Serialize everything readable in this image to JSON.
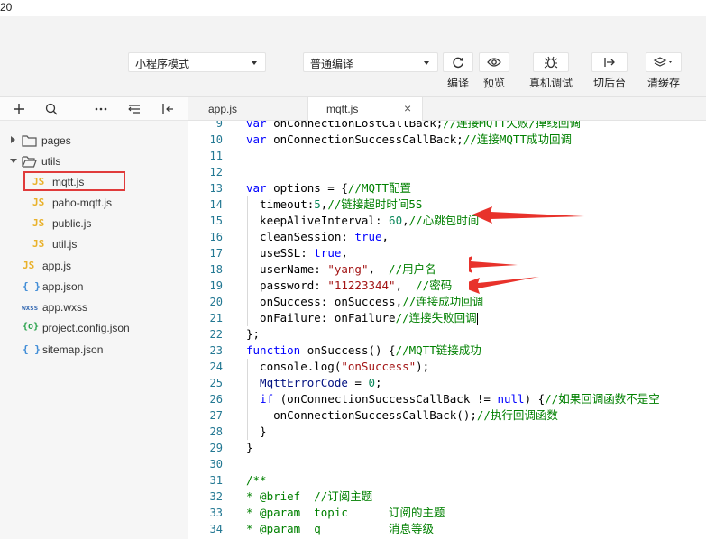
{
  "top_strip": {
    "text": "20"
  },
  "toolbar": {
    "mode_select": "小程序模式",
    "compile_select": "普通编译",
    "buttons": [
      {
        "label": "编译",
        "icon": "refresh-icon"
      },
      {
        "label": "预览",
        "icon": "eye-icon"
      },
      {
        "label": "真机调试",
        "icon": "bug-icon"
      },
      {
        "label": "切后台",
        "icon": "switch-background-icon"
      },
      {
        "label": "清缓存",
        "icon": "layers-icon"
      }
    ]
  },
  "sidebar": {
    "tools": [
      "add-icon",
      "search-icon",
      "more-icon",
      "sort-icon",
      "collapse-icon"
    ],
    "tree": [
      {
        "name": "pages",
        "type": "folder",
        "expanded": false
      },
      {
        "name": "utils",
        "type": "folder",
        "expanded": true
      },
      {
        "name": "mqtt.js",
        "type": "js",
        "badge": "JS",
        "selected": true
      },
      {
        "name": "paho-mqtt.js",
        "type": "js",
        "badge": "JS"
      },
      {
        "name": "public.js",
        "type": "js",
        "badge": "JS"
      },
      {
        "name": "util.js",
        "type": "js",
        "badge": "JS"
      },
      {
        "name": "app.js",
        "type": "js",
        "badge": "JS"
      },
      {
        "name": "app.json",
        "type": "json",
        "badge": "{ }"
      },
      {
        "name": "app.wxss",
        "type": "wxss",
        "badge": "wxss"
      },
      {
        "name": "project.config.json",
        "type": "config",
        "badge": "{o}"
      },
      {
        "name": "sitemap.json",
        "type": "json",
        "badge": "{ }"
      }
    ]
  },
  "tabs": [
    {
      "label": "app.js",
      "active": false
    },
    {
      "label": "mqtt.js",
      "active": true,
      "close": "×"
    }
  ],
  "editor": {
    "lines": [
      {
        "n": "9",
        "tokens": [
          [
            "kw",
            "var"
          ],
          [
            "plain",
            " onConnectionLostCallBack;"
          ],
          [
            "cm",
            "//连接MQTT失败/掉线回调"
          ]
        ]
      },
      {
        "n": "10",
        "tokens": [
          [
            "kw",
            "var"
          ],
          [
            "plain",
            " onConnectionSuccessCallBack;"
          ],
          [
            "cm",
            "//连接MQTT成功回调"
          ]
        ]
      },
      {
        "n": "11",
        "tokens": []
      },
      {
        "n": "12",
        "tokens": []
      },
      {
        "n": "13",
        "tokens": [
          [
            "kw",
            "var"
          ],
          [
            "plain",
            " options = {"
          ],
          [
            "cm",
            "//MQTT配置"
          ]
        ]
      },
      {
        "n": "14",
        "tokens": [
          [
            "plain",
            "  timeout:"
          ],
          [
            "num",
            "5"
          ],
          [
            "plain",
            ","
          ],
          [
            "cm",
            "//链接超时时间5S"
          ]
        ]
      },
      {
        "n": "15",
        "tokens": [
          [
            "plain",
            "  keepAliveInterval: "
          ],
          [
            "num",
            "60"
          ],
          [
            "plain",
            ","
          ],
          [
            "cm",
            "//心跳包时间"
          ]
        ]
      },
      {
        "n": "16",
        "tokens": [
          [
            "plain",
            "  cleanSession: "
          ],
          [
            "kw",
            "true"
          ],
          [
            "plain",
            ","
          ]
        ]
      },
      {
        "n": "17",
        "tokens": [
          [
            "plain",
            "  useSSL: "
          ],
          [
            "kw",
            "true"
          ],
          [
            "plain",
            ","
          ]
        ]
      },
      {
        "n": "18",
        "tokens": [
          [
            "plain",
            "  userName: "
          ],
          [
            "str",
            "\"yang\""
          ],
          [
            "plain",
            ",  "
          ],
          [
            "cm",
            "//用户名"
          ]
        ]
      },
      {
        "n": "19",
        "tokens": [
          [
            "plain",
            "  password: "
          ],
          [
            "str",
            "\"11223344\""
          ],
          [
            "plain",
            ",  "
          ],
          [
            "cm",
            "//密码"
          ]
        ]
      },
      {
        "n": "20",
        "tokens": [
          [
            "plain",
            "  onSuccess: onSuccess,"
          ],
          [
            "cm",
            "//连接成功回调"
          ]
        ]
      },
      {
        "n": "21",
        "tokens": [
          [
            "plain",
            "  onFailure: onFailure"
          ],
          [
            "cm",
            "//连接失败回调"
          ]
        ],
        "cursor": true
      },
      {
        "n": "22",
        "tokens": [
          [
            "plain",
            "};"
          ]
        ]
      },
      {
        "n": "23",
        "tokens": [
          [
            "kw",
            "function"
          ],
          [
            "plain",
            " onSuccess() {"
          ],
          [
            "cm",
            "//MQTT链接成功"
          ]
        ]
      },
      {
        "n": "24",
        "tokens": [
          [
            "plain",
            "  console.log("
          ],
          [
            "str",
            "\"onSuccess\""
          ],
          [
            "plain",
            ");"
          ]
        ]
      },
      {
        "n": "25",
        "tokens": [
          [
            "prop",
            "  MqttErrorCode"
          ],
          [
            "plain",
            " = "
          ],
          [
            "num",
            "0"
          ],
          [
            "plain",
            ";"
          ]
        ]
      },
      {
        "n": "26",
        "tokens": [
          [
            "kw",
            "  if"
          ],
          [
            "plain",
            " (onConnectionSuccessCallBack != "
          ],
          [
            "kw",
            "null"
          ],
          [
            "plain",
            ") {"
          ],
          [
            "cm",
            "//如果回调函数不是空"
          ]
        ]
      },
      {
        "n": "27",
        "tokens": [
          [
            "plain",
            "    onConnectionSuccessCallBack();"
          ],
          [
            "cm",
            "//执行回调函数"
          ]
        ]
      },
      {
        "n": "28",
        "tokens": [
          [
            "plain",
            "  }"
          ]
        ]
      },
      {
        "n": "29",
        "tokens": [
          [
            "plain",
            "}"
          ]
        ]
      },
      {
        "n": "30",
        "tokens": []
      },
      {
        "n": "31",
        "tokens": [
          [
            "cm",
            "/**"
          ]
        ]
      },
      {
        "n": "32",
        "tokens": [
          [
            "cm",
            "* @brief  //订阅主题"
          ]
        ]
      },
      {
        "n": "33",
        "tokens": [
          [
            "cm",
            "* @param  topic      订阅的主题"
          ]
        ]
      },
      {
        "n": "34",
        "tokens": [
          [
            "cm",
            "* @param  q          消息等级"
          ]
        ]
      }
    ]
  },
  "annotation_color": "#e8322b",
  "selection_color": "#e03b3b"
}
